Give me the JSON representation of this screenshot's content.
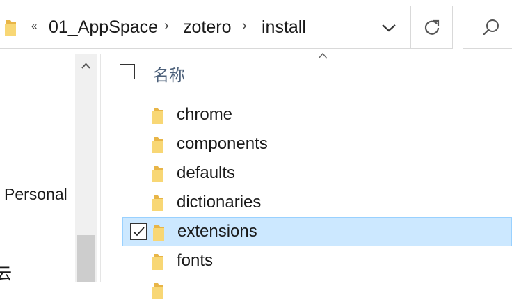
{
  "address_bar": {
    "overflow": "«",
    "crumbs": [
      "01_AppSpace",
      "zotero",
      "install"
    ],
    "separator": "›"
  },
  "nav_pane": {
    "items": [
      "Personal"
    ],
    "partial_item": "云"
  },
  "content": {
    "column_name": "名称",
    "rows": [
      {
        "name": "chrome",
        "selected": false
      },
      {
        "name": "components",
        "selected": false
      },
      {
        "name": "defaults",
        "selected": false
      },
      {
        "name": "dictionaries",
        "selected": false
      },
      {
        "name": "extensions",
        "selected": true
      },
      {
        "name": "fonts",
        "selected": false
      }
    ]
  },
  "colors": {
    "selection_bg": "#cce8ff",
    "selection_border": "#99d1ff",
    "folder": "#f8d775",
    "header_text": "#4c607a"
  },
  "icons": [
    "folder-icon",
    "chevron-down-icon",
    "refresh-icon",
    "search-icon",
    "scroll-up-icon",
    "sort-up-icon",
    "checkbox-icon",
    "checkmark-icon"
  ]
}
